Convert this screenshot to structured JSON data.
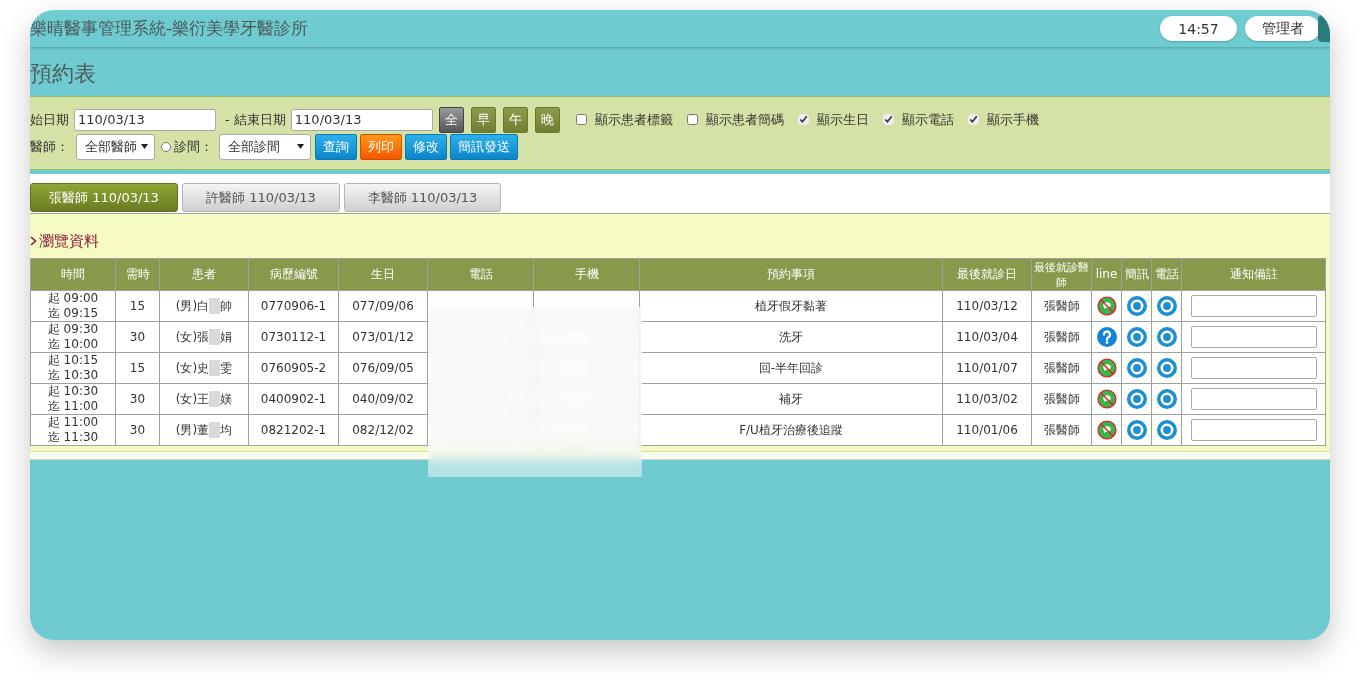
{
  "header": {
    "title": "樂晴醫事管理系統-樂衍美學牙醫診所",
    "clock": "14:57",
    "user": "管理者"
  },
  "page_title": "預約表",
  "filters": {
    "start_label": "始日期",
    "start_value": "110/03/13",
    "end_label": "- 結束日期",
    "end_value": "110/03/13",
    "periods": [
      {
        "label": "全",
        "selected": true
      },
      {
        "label": "早",
        "selected": false
      },
      {
        "label": "午",
        "selected": false
      },
      {
        "label": "晚",
        "selected": false
      }
    ],
    "options": [
      {
        "label": "顯示患者標籤",
        "checked": false
      },
      {
        "label": "顯示患者簡碼",
        "checked": false
      },
      {
        "label": "顯示生日",
        "checked": true
      },
      {
        "label": "顯示電話",
        "checked": true
      },
      {
        "label": "顯示手機",
        "checked": true
      }
    ],
    "doctor_label": "醫師：",
    "doctor_value": "全部醫師",
    "room_radio_checked": false,
    "room_label": "診間：",
    "room_value": "全部診間",
    "actions": [
      {
        "label": "查詢",
        "kind": "primary"
      },
      {
        "label": "列印",
        "kind": "accent"
      },
      {
        "label": "修改",
        "kind": "primary"
      },
      {
        "label": "簡訊發送",
        "kind": "primary"
      }
    ]
  },
  "tabs": [
    {
      "label": "張醫師 110/03/13",
      "selected": true
    },
    {
      "label": "許醫師 110/03/13",
      "selected": false
    },
    {
      "label": "李醫師 110/03/13",
      "selected": false
    }
  ],
  "section_title": "瀏覽資料",
  "table": {
    "columns": [
      "時間",
      "需時",
      "患者",
      "病歷編號",
      "生日",
      "電話",
      "手機",
      "預約事項",
      "最後就診日",
      "最後就診醫師",
      "line",
      "簡訊",
      "電話",
      "通知備註"
    ],
    "rows": [
      {
        "start": "起 09:00",
        "end": "迄 09:15",
        "duration": "15",
        "patient_before": "(男)白",
        "patient_after": "帥",
        "record_no": "0770906-1",
        "birthday": "077/09/06",
        "item": "植牙假牙黏著",
        "last_visit": "110/03/12",
        "last_doctor": "張醫師",
        "line_icon": {
          "kind": "blocked"
        }
      },
      {
        "start": "起 09:30",
        "end": "迄 10:00",
        "duration": "30",
        "patient_before": "(女)張",
        "patient_after": "娟",
        "record_no": "0730112-1",
        "birthday": "073/01/12",
        "item": "洗牙",
        "last_visit": "110/03/04",
        "last_doctor": "張醫師",
        "line_icon": {
          "kind": "unknown"
        }
      },
      {
        "start": "起 10:15",
        "end": "迄 10:30",
        "duration": "15",
        "patient_before": "(女)史",
        "patient_after": "雯",
        "record_no": "0760905-2",
        "birthday": "076/09/05",
        "item": "回-半年回診",
        "last_visit": "110/01/07",
        "last_doctor": "張醫師",
        "line_icon": {
          "kind": "blocked"
        }
      },
      {
        "start": "起 10:30",
        "end": "迄 11:00",
        "duration": "30",
        "patient_before": "(女)王",
        "patient_after": "媄",
        "record_no": "0400902-1",
        "birthday": "040/09/02",
        "item": "補牙",
        "last_visit": "110/03/02",
        "last_doctor": "張醫師",
        "line_icon": {
          "kind": "blocked"
        }
      },
      {
        "start": "起 11:00",
        "end": "迄 11:30",
        "duration": "30",
        "patient_before": "(男)董",
        "patient_after": "均",
        "record_no": "0821202-1",
        "birthday": "082/12/02",
        "item": "F/U植牙治療後追蹤",
        "last_visit": "110/01/06",
        "last_doctor": "張醫師",
        "line_icon": {
          "kind": "blocked"
        }
      }
    ]
  }
}
